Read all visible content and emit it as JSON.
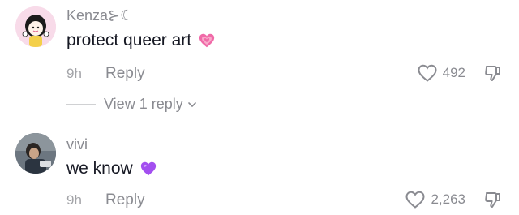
{
  "comments": [
    {
      "username": "Kenza⊱☾",
      "text": "protect queer art",
      "emoji": "pink-heart-emoji",
      "time": "9h",
      "reply_label": "Reply",
      "likes": "492"
    },
    {
      "username": "vivi",
      "text": "we know",
      "emoji": "purple-heart-emoji",
      "time": "9h",
      "reply_label": "Reply",
      "likes": "2,263"
    }
  ],
  "view_replies_label": "View 1 reply",
  "colors": {
    "pink_heart": "#f06aa8",
    "purple_heart": "#a34ff0",
    "meta_text": "#8a8b91",
    "main_text": "#161823"
  }
}
